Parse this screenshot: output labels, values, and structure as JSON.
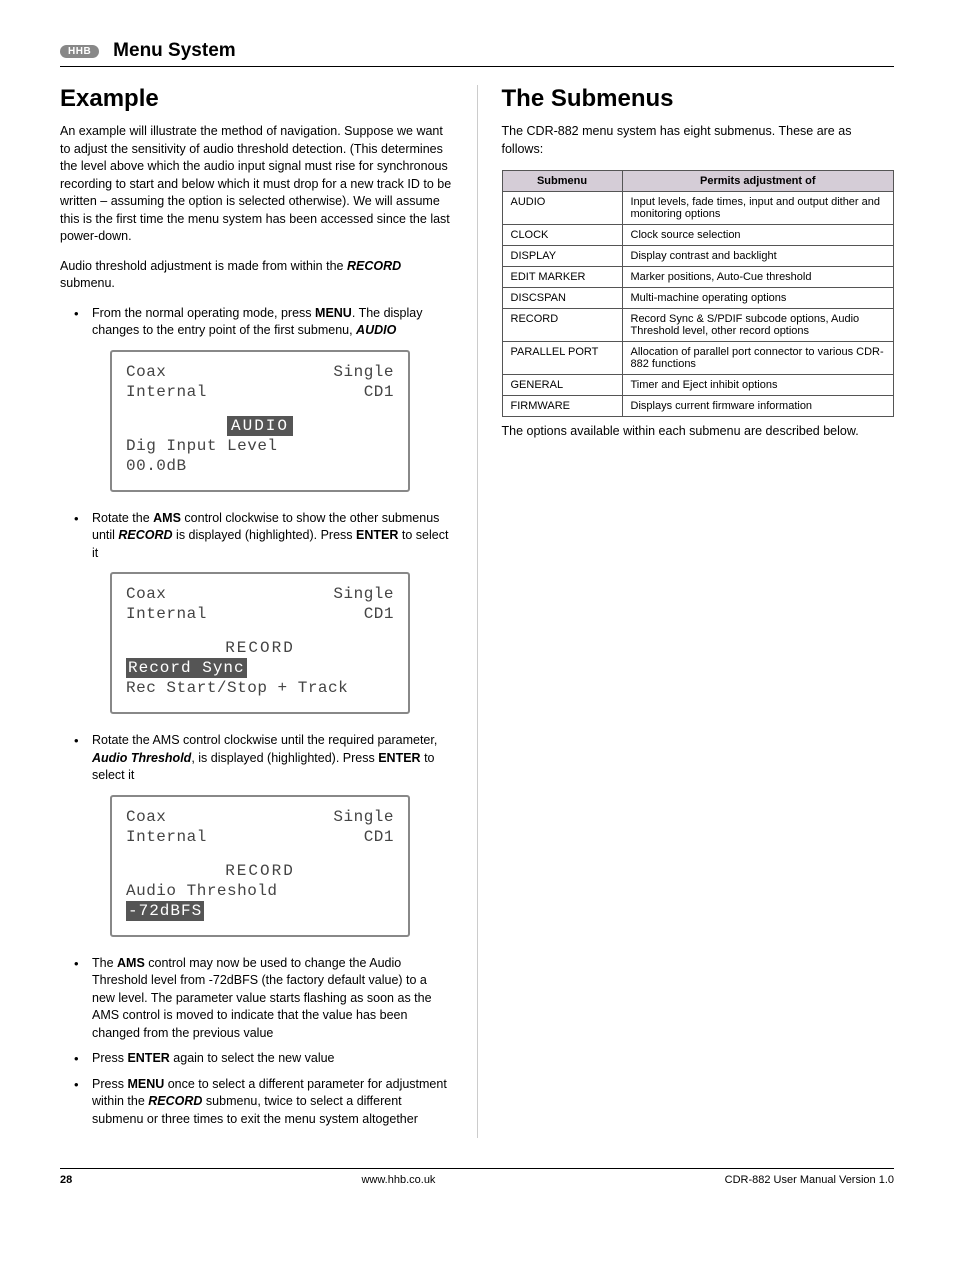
{
  "header": {
    "brand": "HHB",
    "title": "Menu System"
  },
  "left": {
    "heading": "Example",
    "p1": "An example will illustrate the method of navigation. Suppose we want to adjust the sensitivity of audio threshold detection. (This determines the level above which the audio input signal must rise for synchronous recording to start and below which it must drop for a new track ID to be written – assuming the option is selected otherwise). We will assume this is the first time the menu system has been accessed since the last power-down.",
    "p2_a": "Audio threshold adjustment is made from within the ",
    "p2_b": "RECORD",
    "p2_c": " submenu.",
    "step1_a": "From the normal operating mode, press ",
    "step1_menu": "MENU",
    "step1_b": ". The display changes to the entry point of the first submenu, ",
    "step1_audio": "AUDIO",
    "lcd1": {
      "r1l": "Coax",
      "r1r": "Single",
      "r2l": "Internal",
      "r2r": "CD1",
      "title": "AUDIO",
      "l1": "Dig Input Level",
      "l2": "00.0dB"
    },
    "step2_a": "Rotate the ",
    "step2_ams": "AMS",
    "step2_b": " control clockwise to show the other submenus until ",
    "step2_rec": "RECORD",
    "step2_c": " is displayed (highlighted). Press ",
    "step2_enter": "ENTER",
    "step2_d": " to select it",
    "lcd2": {
      "r1l": "Coax",
      "r1r": "Single",
      "r2l": "Internal",
      "r2r": "CD1",
      "title": "RECORD",
      "l1": "Record Sync",
      "l2": "Rec Start/Stop + Track"
    },
    "step3_a": "Rotate the AMS control clockwise until the required parameter, ",
    "step3_at": "Audio Threshold",
    "step3_b": ", is displayed (highlighted). Press ",
    "step3_enter": "ENTER",
    "step3_c": " to select it",
    "lcd3": {
      "r1l": "Coax",
      "r1r": "Single",
      "r2l": "Internal",
      "r2r": "CD1",
      "title": "RECORD",
      "l1": "Audio Threshold",
      "l2": "-72dBFS"
    },
    "step4_a": "The ",
    "step4_ams": "AMS",
    "step4_b": " control may now be used to change the Audio Threshold level from -72dBFS (the factory default value) to a new level. The parameter value starts flashing as soon as the AMS control is moved to indicate that the value has been changed from the previous value",
    "step5_a": "Press ",
    "step5_enter": "ENTER",
    "step5_b": " again to select the new value",
    "step6_a": "Press ",
    "step6_menu": "MENU",
    "step6_b": " once to select a different parameter for adjustment within the ",
    "step6_rec": "RECORD",
    "step6_c": " submenu, twice to select a different submenu or three times to exit the menu system altogether"
  },
  "right": {
    "heading": "The Submenus",
    "p1": "The CDR-882 menu system has eight submenus. These are as follows:",
    "th1": "Submenu",
    "th2": "Permits adjustment of",
    "rows": [
      {
        "n": "AUDIO",
        "d": "Input levels, fade times, input and output dither and monitoring options"
      },
      {
        "n": "CLOCK",
        "d": "Clock source selection"
      },
      {
        "n": "DISPLAY",
        "d": "Display contrast and backlight"
      },
      {
        "n": "EDIT MARKER",
        "d": "Marker positions, Auto-Cue threshold"
      },
      {
        "n": "DISCSPAN",
        "d": "Multi-machine operating options"
      },
      {
        "n": "RECORD",
        "d": "Record Sync & S/PDIF subcode options, Audio Threshold level, other record options"
      },
      {
        "n": "PARALLEL PORT",
        "d": "Allocation of parallel port connector to various CDR-882 functions"
      },
      {
        "n": "GENERAL",
        "d": "Timer and Eject inhibit options"
      },
      {
        "n": "FIRMWARE",
        "d": "Displays current firmware information"
      }
    ],
    "p2": "The options available within each submenu are described below."
  },
  "footer": {
    "page": "28",
    "center": "www.hhb.co.uk",
    "right": "CDR-882 User Manual Version 1.0"
  }
}
